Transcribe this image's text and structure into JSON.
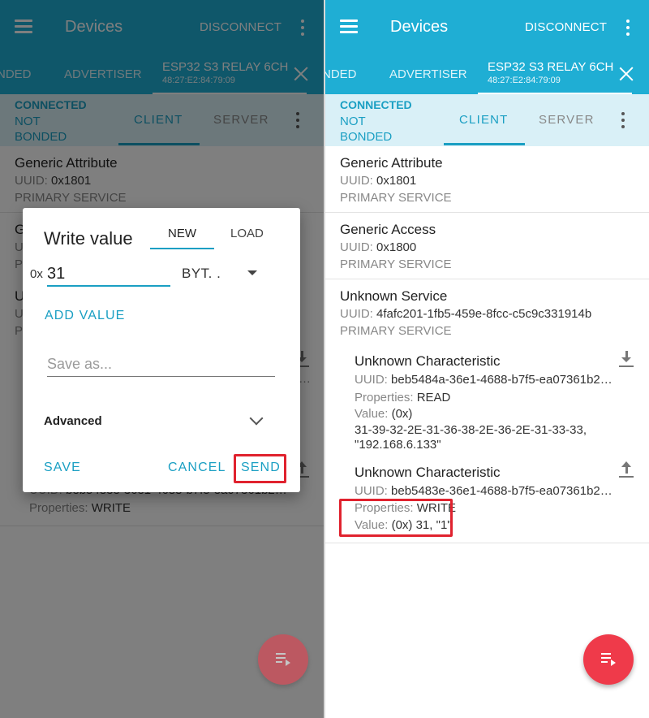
{
  "colors": {
    "primary": "#1faed4",
    "accent": "#1a9fc3",
    "connection_bar": "#d9f0f7",
    "fab": "#ef3a4a",
    "highlight": "#e0222e"
  },
  "appbar": {
    "title": "Devices",
    "disconnect_label": "DISCONNECT"
  },
  "device_tabs": {
    "left_tab": "BONDED",
    "left_tab_visible": "NDED",
    "advertiser": "ADVERTISER",
    "active_name": "ESP32 S3 RELAY 6CH",
    "active_mac": "48:27:E2:84:79:09"
  },
  "connection": {
    "status": "CONNECTED",
    "bond": "NOT BONDED",
    "tab_client": "CLIENT",
    "tab_server": "SERVER"
  },
  "uuid_label": "UUID:",
  "properties_label": "Properties:",
  "value_label": "Value:",
  "services": [
    {
      "name": "Generic Attribute",
      "uuid": "0x1801",
      "type": "PRIMARY SERVICE"
    },
    {
      "name": "Generic Access",
      "uuid": "0x1800",
      "type": "PRIMARY SERVICE"
    },
    {
      "name": "Unknown Service",
      "uuid": "4fafc201-1fb5-459e-8fcc-c5c9c331914b",
      "type": "PRIMARY SERVICE"
    }
  ],
  "characteristics": [
    {
      "name": "Unknown Characteristic",
      "uuid": "beb5484a-36e1-4688-b7f5-ea07361b2…",
      "properties": "READ",
      "value_line1": "(0x)",
      "value_line2": "31-39-32-2E-31-36-38-2E-36-2E-31-33-33,",
      "value_line3": "\"192.168.6.133\"",
      "icon": "download-icon"
    },
    {
      "name": "Unknown Characteristic",
      "uuid": "beb5483e-36e1-4688-b7f5-ea07361b2…",
      "properties": "WRITE",
      "value": "(0x) 31, \"1\"",
      "icon": "upload-icon"
    }
  ],
  "left_partial": {
    "service_initial": "G",
    "unknown_initial": "U",
    "uuid_initial": "U",
    "p_initial": "P",
    "char2_uuid_fragment": "beb5483e-36e1-4688-b7f5-ea07361b2…",
    "char2_properties": "WRITE",
    "ellipsis": "…"
  },
  "dialog": {
    "title": "Write value",
    "tab_new": "NEW",
    "tab_load": "LOAD",
    "hex_prefix": "0x",
    "hex_value": "31",
    "format": "BYT. .",
    "add_value": "ADD VALUE",
    "save_as_placeholder": "Save as...",
    "advanced": "Advanced",
    "save": "SAVE",
    "cancel": "CANCEL",
    "send": "SEND"
  }
}
